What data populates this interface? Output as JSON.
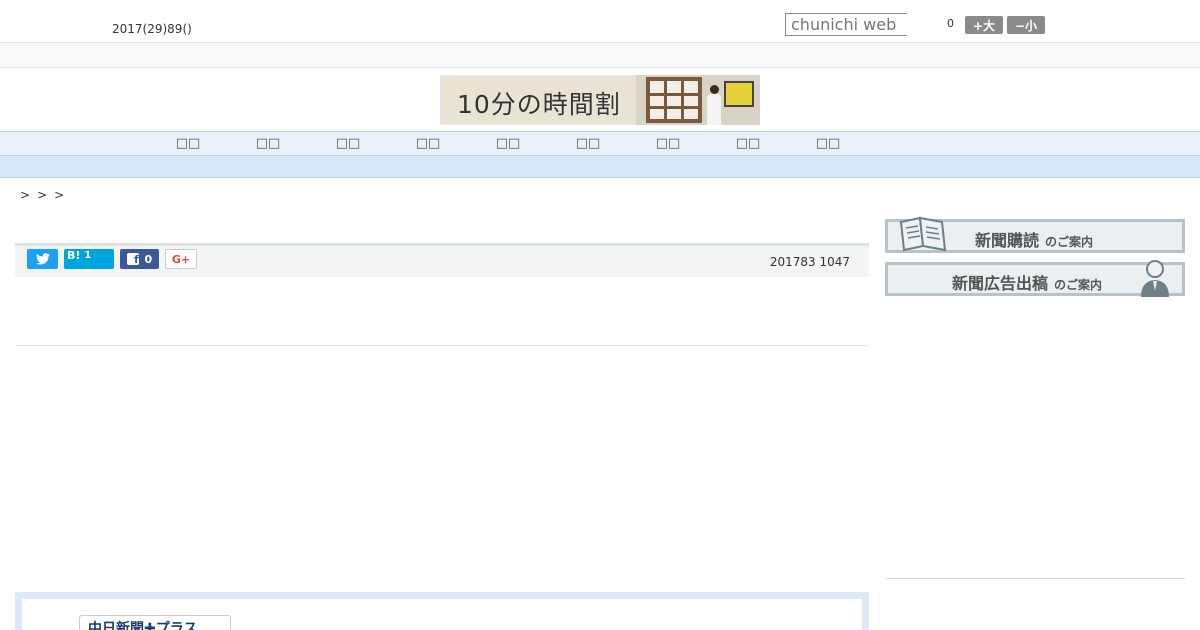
{
  "header": {
    "date": "2017(29)89()",
    "search_placeholder": "chunichi web",
    "count": "0",
    "font_bigger": "+大",
    "font_smaller": "−小"
  },
  "banner": {
    "text": "10分の時間割"
  },
  "nav": {
    "items": [
      "□□",
      "□□",
      "□□",
      "□□",
      "□□",
      "□□",
      "□□",
      "□□",
      "□□"
    ]
  },
  "breadcrumb": [
    ">",
    ">",
    ">"
  ],
  "share": {
    "hatena_label": "B!",
    "hatena_count": "1",
    "facebook_count": "0",
    "gplus_label": "G+"
  },
  "article": {
    "published": "201783 1047"
  },
  "sidebar": {
    "card1": {
      "main": "新聞購読",
      "sub": "のご案内"
    },
    "card2": {
      "main": "新聞広告出稿",
      "sub": "のご案内"
    }
  },
  "bottom": {
    "logo_text": "中日新聞✚プラス"
  },
  "colors": {
    "twitter": "#1da1f2",
    "hatena": "#00a4de",
    "facebook": "#3b5998",
    "nav_bg": "#e9f2fb"
  }
}
